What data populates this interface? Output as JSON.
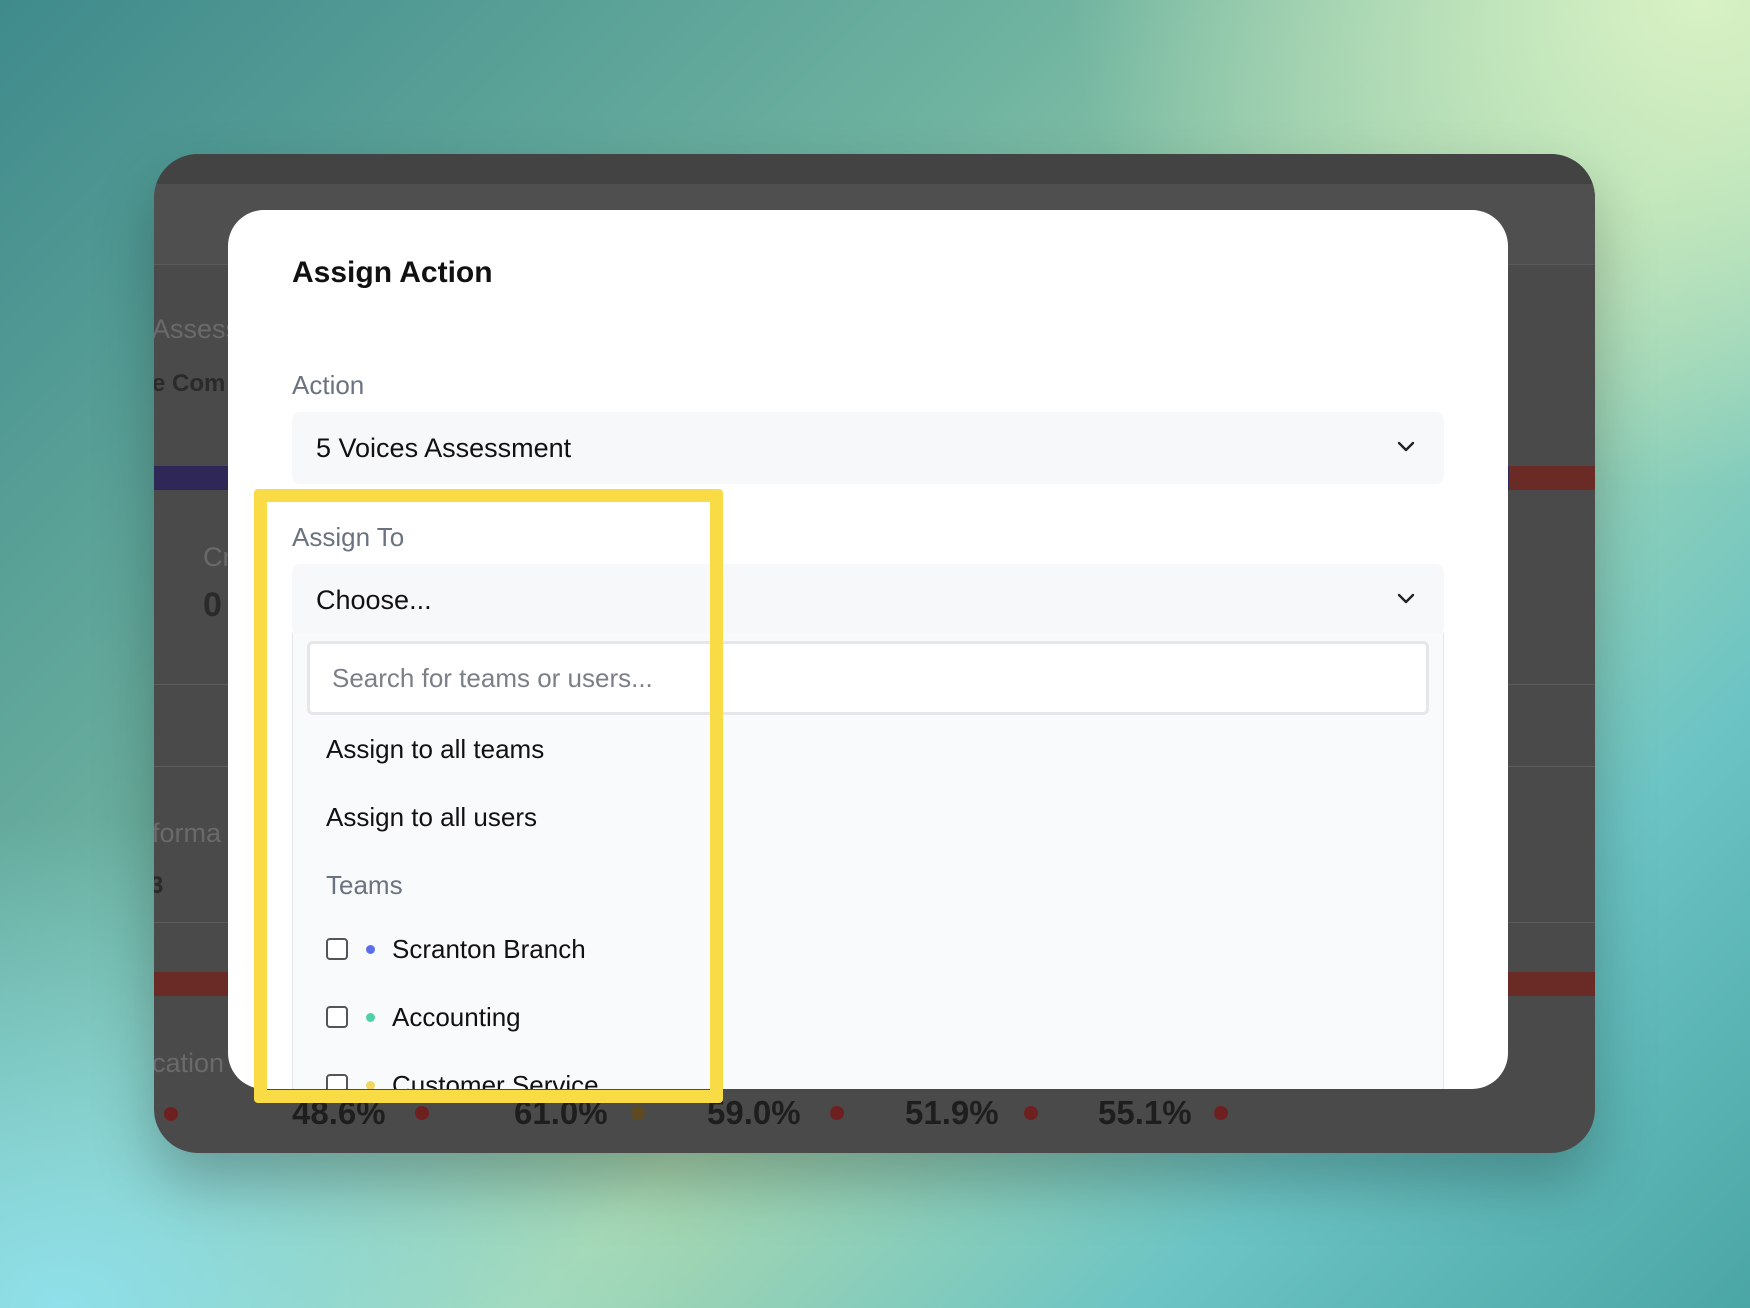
{
  "background_app": {
    "fragments": {
      "assessment": "Assess",
      "company": "e Com",
      "card_label": "Cr",
      "card_value": "0",
      "performance": "forma",
      "small_value": "3",
      "communication": "cation"
    },
    "percentages": [
      "48.6%",
      "61.0%",
      "59.0%",
      "51.9%",
      "55.1%"
    ],
    "colors": {
      "accent_purple": "#2f2856",
      "accent_red": "#6a2a26",
      "dot_red": "#6e2020",
      "dot_brown": "#5e4a20"
    }
  },
  "modal": {
    "title": "Assign Action",
    "action": {
      "label": "Action",
      "selected": "5 Voices Assessment",
      "icon": "chevron-down-icon"
    },
    "assign_to": {
      "label": "Assign To",
      "selected": "Choose...",
      "icon": "chevron-down-icon",
      "search_placeholder": "Search for teams or users...",
      "options": [
        "Assign to all teams",
        "Assign to all users"
      ],
      "group_label": "Teams",
      "teams": [
        {
          "name": "Scranton Branch",
          "color": "#5b6ee8",
          "checked": false
        },
        {
          "name": "Accounting",
          "color": "#4fd1a5",
          "checked": false
        },
        {
          "name": "Customer Service",
          "color": "#f0d860",
          "checked": false
        }
      ]
    }
  },
  "highlight_color": "#f8db45"
}
